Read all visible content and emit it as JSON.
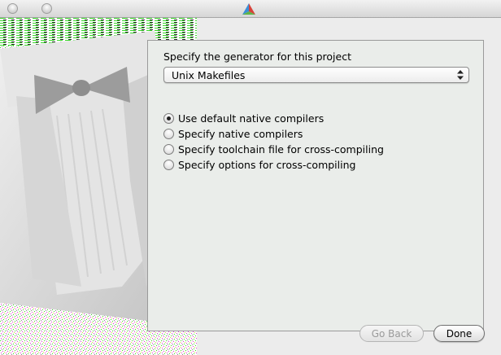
{
  "window": {
    "title": ""
  },
  "panel": {
    "title": "Specify the generator for this project",
    "generator": {
      "selected": "Unix Makefiles"
    },
    "options": [
      {
        "label": "Use default native compilers",
        "checked": true
      },
      {
        "label": "Specify native compilers",
        "checked": false
      },
      {
        "label": "Specify toolchain file for cross-compiling",
        "checked": false
      },
      {
        "label": "Specify options for cross-compiling",
        "checked": false
      }
    ]
  },
  "buttons": {
    "back_label": "Go Back",
    "back_enabled": false,
    "done_label": "Done"
  },
  "colors": {
    "artwork_green": "#3cd62c",
    "artwork_magenta": "#e03ad8",
    "artwork_jacket": "#c8c8c8"
  }
}
